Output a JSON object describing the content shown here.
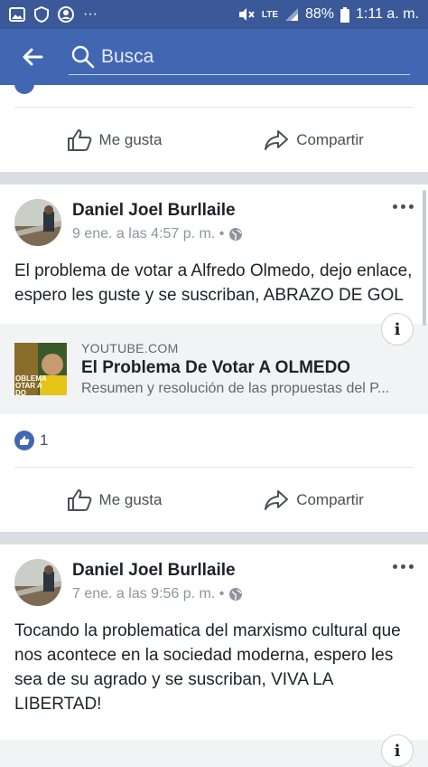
{
  "status": {
    "battery": "88%",
    "time": "1:11 a. m.",
    "network": "LTE"
  },
  "search": {
    "placeholder": "Busca"
  },
  "actions": {
    "like": "Me gusta",
    "share": "Compartir"
  },
  "posts": [
    {
      "author": "Daniel Joel Burllaile",
      "date": "9 ene. a las 4:57 p. m. •",
      "text": "El problema de votar a Alfredo Olmedo, dejo enlace, espero les guste y se suscriban, ABRAZO DE GOL",
      "link": {
        "domain": "YOUTUBE.COM",
        "title": "El Problema De Votar A OLMEDO",
        "description": "Resumen y resolución de las propuestas del P...",
        "thumb_text": "OBLEMA\nOTAR A\nDO"
      },
      "like_count": "1"
    },
    {
      "author": "Daniel Joel Burllaile",
      "date": "7 ene. a las 9:56 p. m. •",
      "text": "Tocando la problematica del marxismo cultural que nos acontece en la sociedad moderna, espero les sea de su agrado y se suscriban, VIVA LA LIBERTAD!"
    }
  ],
  "colors": {
    "brand": "#4267b2",
    "status": "#3b5998"
  }
}
